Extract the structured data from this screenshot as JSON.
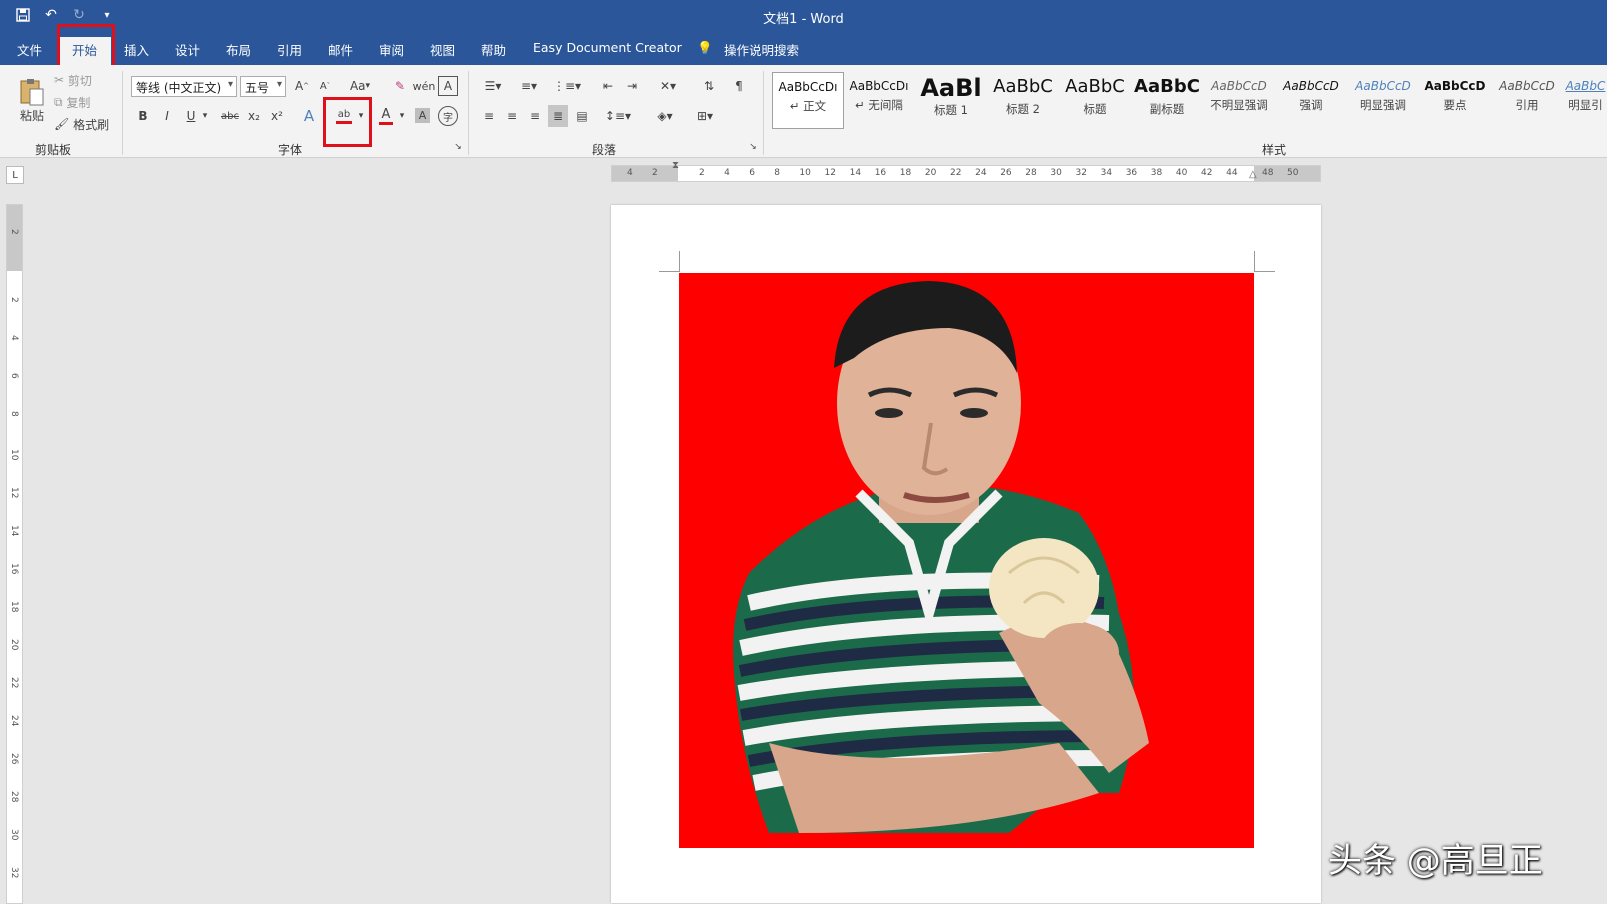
{
  "window": {
    "title": "文档1  -  Word"
  },
  "qat": {
    "save_icon": "save-icon",
    "undo_icon": "undo-icon",
    "redo_icon": "redo-icon",
    "customize_icon": "chevron-down-icon"
  },
  "tabs": [
    {
      "label": "文件"
    },
    {
      "label": "开始"
    },
    {
      "label": "插入"
    },
    {
      "label": "设计"
    },
    {
      "label": "布局"
    },
    {
      "label": "引用"
    },
    {
      "label": "邮件"
    },
    {
      "label": "审阅"
    },
    {
      "label": "视图"
    },
    {
      "label": "帮助"
    },
    {
      "label": "Easy Document Creator"
    },
    {
      "label": "操作说明搜索"
    }
  ],
  "clipboard": {
    "paste": "粘贴",
    "cut": "剪切",
    "copy": "复制",
    "format_painter": "格式刷",
    "group": "剪贴板"
  },
  "font": {
    "name": "等线 (中文正文)",
    "size": "五号",
    "group": "字体",
    "bold": "B",
    "italic": "I",
    "underline": "U",
    "strike": "abc",
    "sub": "x₂",
    "sup": "x²",
    "aa": "Aa",
    "highlight": "ab",
    "font_color": "A"
  },
  "paragraph": {
    "group": "段落"
  },
  "styles": {
    "group": "样式",
    "items": [
      {
        "preview": "AaBbCcDı",
        "name": "↵ 正文"
      },
      {
        "preview": "AaBbCcDı",
        "name": "↵ 无间隔"
      },
      {
        "preview": "AaBl",
        "name": "标题 1"
      },
      {
        "preview": "AaBbC",
        "name": "标题 2"
      },
      {
        "preview": "AaBbC",
        "name": "标题"
      },
      {
        "preview": "AaBbC",
        "name": "副标题"
      },
      {
        "preview": "AaBbCcD",
        "name": "不明显强调"
      },
      {
        "preview": "AaBbCcD",
        "name": "强调"
      },
      {
        "preview": "AaBbCcD",
        "name": "明显强调"
      },
      {
        "preview": "AaBbCcD",
        "name": "要点"
      },
      {
        "preview": "AaBbCcD",
        "name": "引用"
      },
      {
        "preview": "AaBbC",
        "name": "明显引"
      }
    ]
  },
  "ruler": {
    "h_ticks": [
      "4",
      "2",
      "2",
      "4",
      "6",
      "8",
      "10",
      "12",
      "14",
      "16",
      "18",
      "20",
      "22",
      "24",
      "26",
      "28",
      "30",
      "32",
      "34",
      "36",
      "38",
      "40",
      "42",
      "44",
      "48",
      "50"
    ],
    "v_ticks": [
      "2",
      "2",
      "4",
      "6",
      "8",
      "10",
      "12",
      "14",
      "16",
      "18",
      "20",
      "22",
      "24",
      "26",
      "28",
      "30",
      "32"
    ]
  },
  "watermark": "头条 @高旦正",
  "colors": {
    "title_bar": "#2b579a",
    "highlight_box": "#e0101a",
    "photo_bg": "#ff0000"
  }
}
